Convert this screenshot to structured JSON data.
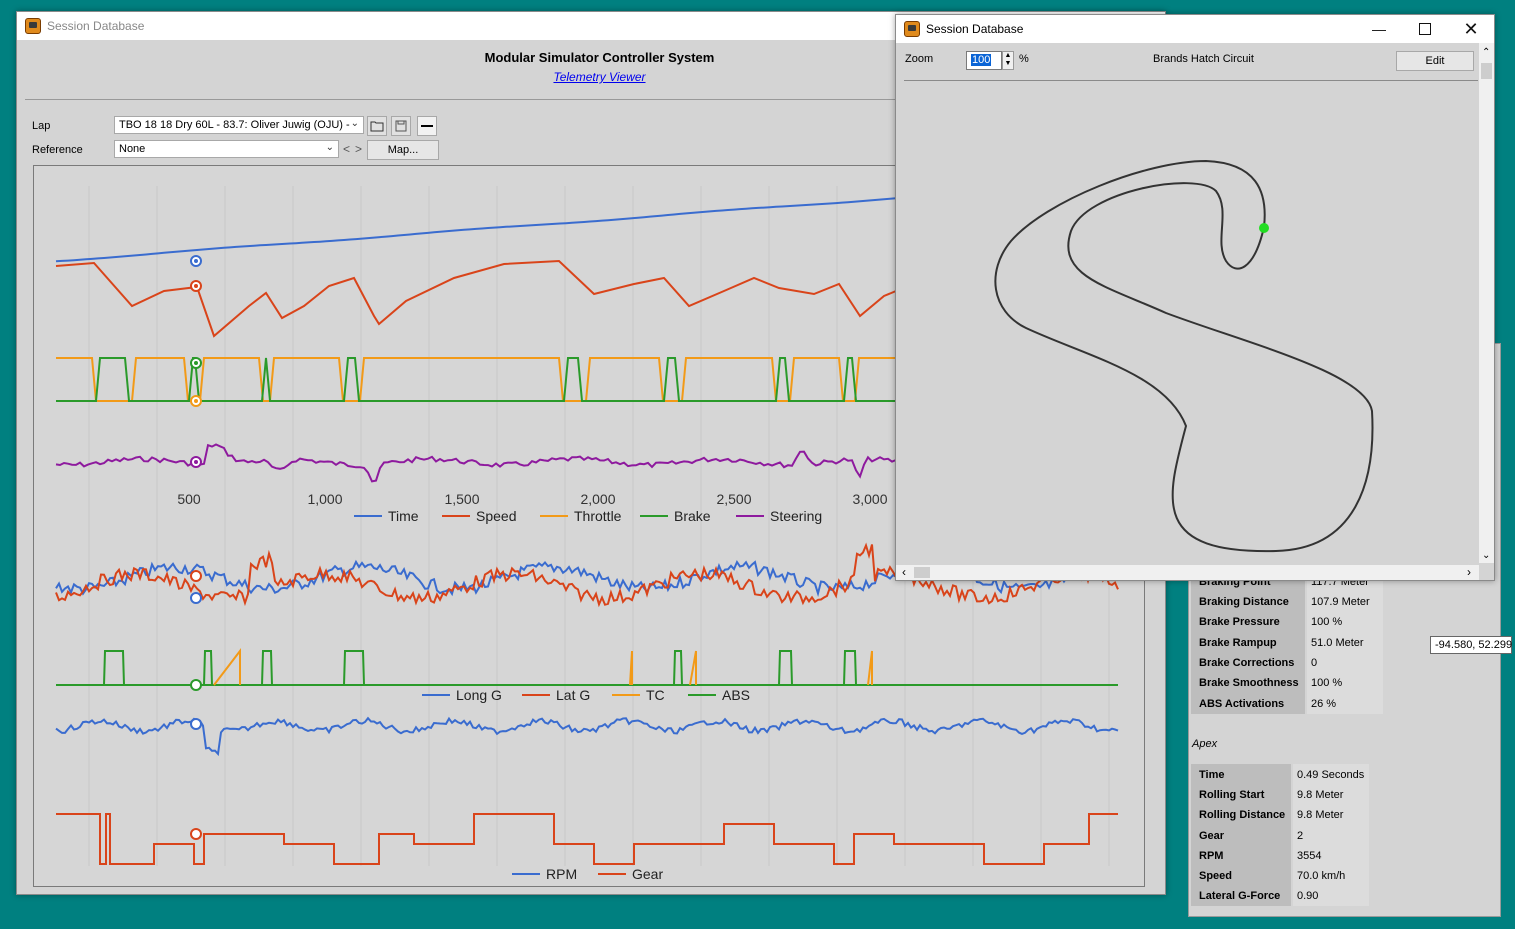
{
  "main_window": {
    "title": "Session Database",
    "system_title": "Modular Simulator Controller System",
    "viewer_link": "Telemetry Viewer",
    "lap_label": "Lap",
    "lap_value": "TBO 18 18 Dry 60L - 83.7: Oliver Juwig (OJU) -",
    "reference_label": "Reference",
    "reference_value": "None",
    "prev_label": "<",
    "next_label": ">",
    "map_button": "Map..."
  },
  "chart1": {
    "x_ticks": [
      "500",
      "1,000",
      "1,500",
      "2,000",
      "2,500",
      "3,000"
    ],
    "legend": [
      {
        "label": "Time",
        "color": "#3a6ccf"
      },
      {
        "label": "Speed",
        "color": "#d9441a"
      },
      {
        "label": "Throttle",
        "color": "#f29a18"
      },
      {
        "label": "Brake",
        "color": "#2a9a2a"
      },
      {
        "label": "Steering",
        "color": "#8e1a9e"
      }
    ]
  },
  "chart2": {
    "legend": [
      {
        "label": "Long G",
        "color": "#3a6ccf"
      },
      {
        "label": "Lat G",
        "color": "#d9441a"
      },
      {
        "label": "TC",
        "color": "#f29a18"
      },
      {
        "label": "ABS",
        "color": "#2a9a2a"
      }
    ]
  },
  "chart3": {
    "legend": [
      {
        "label": "RPM",
        "color": "#3a6ccf"
      },
      {
        "label": "Gear",
        "color": "#d9441a"
      }
    ]
  },
  "map_window": {
    "title": "Session Database",
    "zoom_label": "Zoom",
    "zoom_value": "100",
    "zoom_unit": "%",
    "circuit": "Brands Hatch Circuit",
    "edit_button": "Edit"
  },
  "braking_partial_label": "Braking Point",
  "braking_partial_value": "117.7 Meter",
  "braking": [
    {
      "label": "Braking Distance",
      "value": "107.9 Meter"
    },
    {
      "label": "Brake Pressure",
      "value": "100 %"
    },
    {
      "label": "Brake Rampup",
      "value": "51.0 Meter"
    },
    {
      "label": "Brake Corrections",
      "value": "0"
    },
    {
      "label": "Brake Smoothness",
      "value": "100 %"
    },
    {
      "label": "ABS Activations",
      "value": "26 %"
    }
  ],
  "apex_title": "Apex",
  "apex": [
    {
      "label": "Time",
      "value": "0.49 Seconds"
    },
    {
      "label": "Rolling Start",
      "value": "9.8 Meter"
    },
    {
      "label": "Rolling Distance",
      "value": "9.8 Meter"
    },
    {
      "label": "Gear",
      "value": "2"
    },
    {
      "label": "RPM",
      "value": "3554"
    },
    {
      "label": "Speed",
      "value": "70.0 km/h"
    },
    {
      "label": "Lateral G-Force",
      "value": "0.90"
    }
  ],
  "coord_tooltip": "-94.580, 52.299"
}
